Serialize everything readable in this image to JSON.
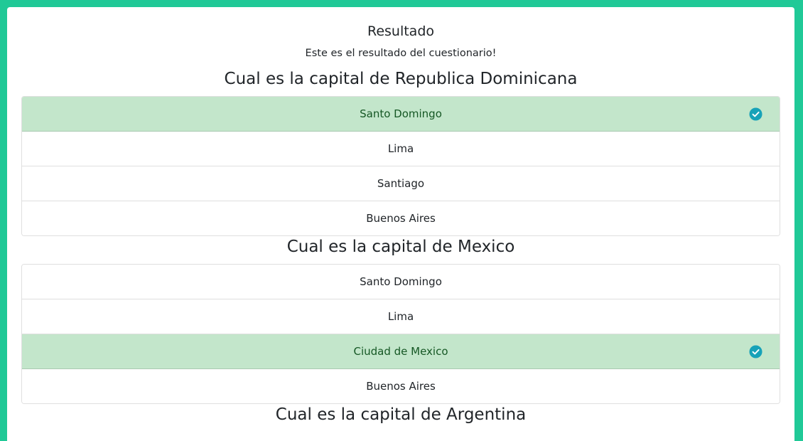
{
  "card": {
    "title": "Resultado",
    "text": "Este es el resultado del cuestionario!"
  },
  "questions": [
    {
      "title": "Cual es la capital de Republica Dominicana",
      "options": [
        {
          "label": "Santo Domingo",
          "correct": true
        },
        {
          "label": "Lima",
          "correct": false
        },
        {
          "label": "Santiago",
          "correct": false
        },
        {
          "label": "Buenos Aires",
          "correct": false
        }
      ]
    },
    {
      "title": "Cual es la capital de Mexico",
      "options": [
        {
          "label": "Santo Domingo",
          "correct": false
        },
        {
          "label": "Lima",
          "correct": false
        },
        {
          "label": "Ciudad de Mexico",
          "correct": true
        },
        {
          "label": "Buenos Aires",
          "correct": false
        }
      ]
    },
    {
      "title": "Cual es la capital de Argentina",
      "options": []
    }
  ],
  "colors": {
    "page_background": "#20c997",
    "correct_background": "#c3e6cb",
    "correct_text": "#155724",
    "check_icon": "#17a2b8"
  },
  "icons": {
    "correct_marker": "check-circle-icon"
  }
}
